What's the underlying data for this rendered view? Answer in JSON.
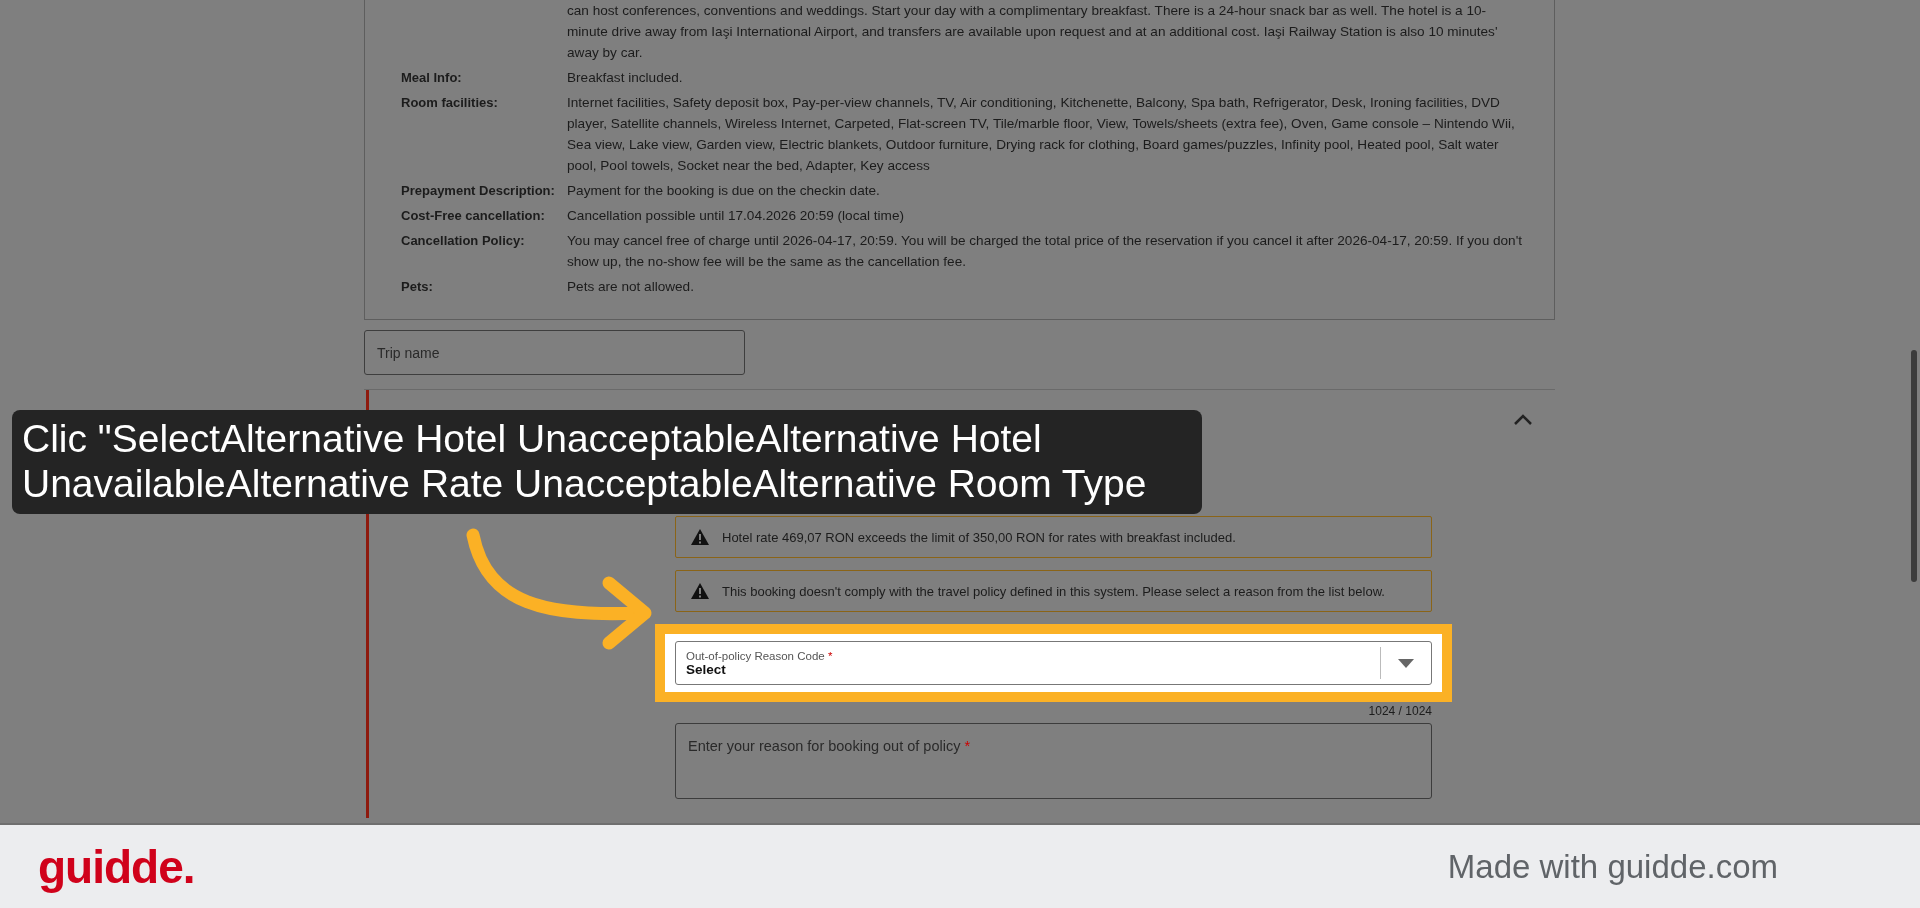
{
  "details": {
    "description": "can host conferences, conventions and weddings. Start your day with a complimentary breakfast. There is a 24-hour snack bar as well. The hotel is a 10-minute drive away from Iaşi International Airport, and transfers are available upon request and at an additional cost. Iaşi Railway Station is also 10 minutes' away by car.",
    "rows": [
      {
        "label": "Meal Info:",
        "value": "Breakfast included."
      },
      {
        "label": "Room facilities:",
        "value": "Internet facilities, Safety deposit box, Pay-per-view channels, TV, Air conditioning, Kitchenette, Balcony, Spa bath, Refrigerator, Desk, Ironing facilities, DVD player, Satellite channels, Wireless Internet, Carpeted, Flat-screen TV, Tile/marble floor, View, Towels/sheets (extra fee), Oven, Game console – Nintendo Wii, Sea view, Lake view, Garden view, Electric blankets, Outdoor furniture, Drying rack for clothing, Board games/puzzles, Infinity pool, Heated pool, Salt water pool, Pool towels, Socket near the bed, Adapter, Key access"
      },
      {
        "label": "Prepayment Description:",
        "value": "Payment for the booking is due on the checkin date."
      },
      {
        "label": "Cost-Free cancellation:",
        "value": "Cancellation possible until 17.04.2026 20:59 (local time)"
      },
      {
        "label": "Cancellation Policy:",
        "value": "You may cancel free of charge until 2026-04-17, 20:59. You will be charged the total price of the reservation if you cancel it after 2026-04-17, 20:59. If you don't show up, the no-show fee will be the same as the cancellation fee."
      },
      {
        "label": "Pets:",
        "value": "Pets are not allowed."
      }
    ]
  },
  "trip_name": {
    "placeholder": "Trip name"
  },
  "policy_section": {
    "expanded": true,
    "warnings": [
      "Hotel rate 469,07 RON exceeds the limit of 350,00 RON for rates with breakfast included.",
      "This booking doesn't comply with the travel policy defined in this system. Please select a reason from the list below."
    ],
    "reason_code": {
      "label": "Out-of-policy Reason Code",
      "required_mark": "*",
      "value": "Select"
    },
    "counter": "1024 / 1024",
    "reason_text": {
      "placeholder": "Enter your reason for booking out of policy",
      "required_mark": "*"
    }
  },
  "callout": {
    "text": "Clic \"SelectAlternative Hotel UnacceptableAlternative Hotel UnavailableAlternative Rate UnacceptableAlternative Room Type"
  },
  "footer": {
    "logo": "guidde.",
    "credit": "Made with guidde.com"
  }
}
